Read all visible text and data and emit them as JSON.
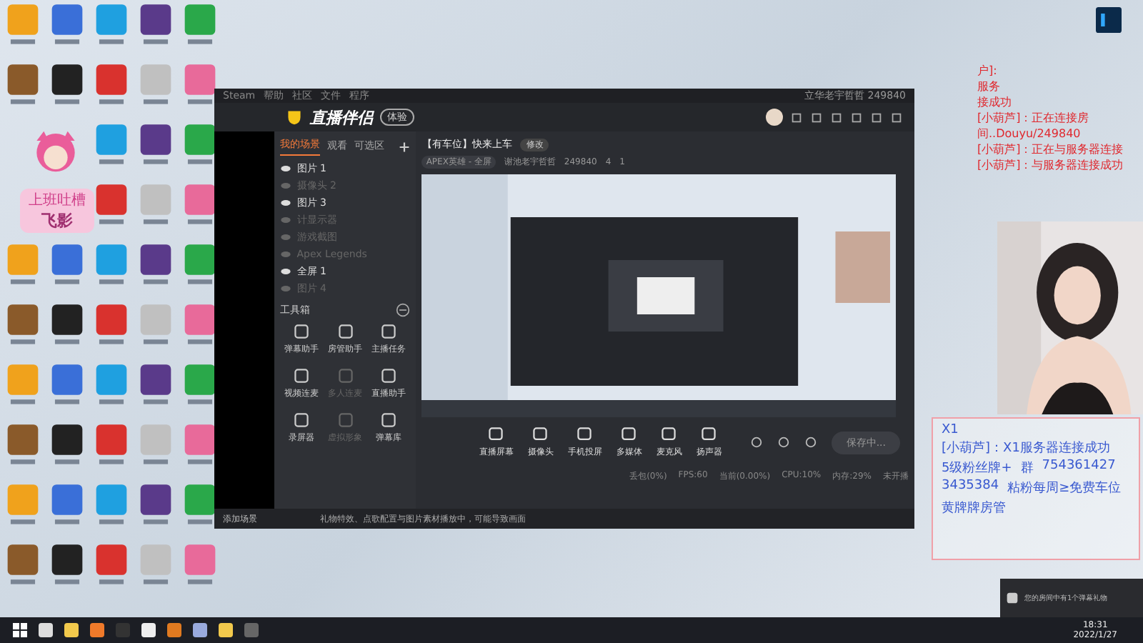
{
  "sticker": {
    "top": "上班吐槽",
    "name": "飞影"
  },
  "window": {
    "menu": [
      "Steam",
      "帮助",
      "社区",
      "文件",
      "程序"
    ],
    "brand": "直播伴侣",
    "badge": "体验",
    "account": "立华老宇哲哲 249840",
    "room": {
      "title": "【有车位】快来上车",
      "edit": "修改",
      "category": "APEX英雄 - 全屏",
      "host": "谢池老宇哲哲",
      "room_id": "249840",
      "likes": "4",
      "viewers": "1"
    },
    "scene_tabs": [
      {
        "label": "我的场景",
        "selected": true
      },
      {
        "label": "观看",
        "selected": false
      },
      {
        "label": "可选区",
        "selected": false
      }
    ],
    "sources": [
      {
        "label": "图片 1",
        "visible": true
      },
      {
        "label": "摄像头 2",
        "visible": false
      },
      {
        "label": "图片 3",
        "visible": true
      },
      {
        "label": "计显示器",
        "visible": false
      },
      {
        "label": "游戏截图",
        "visible": false
      },
      {
        "label": "Apex Legends",
        "visible": false
      },
      {
        "label": "全屏 1",
        "visible": true
      },
      {
        "label": "图片 4",
        "visible": false
      }
    ],
    "toolbox_title": "工具箱",
    "tools": [
      {
        "label": "弹幕助手",
        "disabled": false
      },
      {
        "label": "房管助手",
        "disabled": false
      },
      {
        "label": "主播任务",
        "disabled": false
      },
      {
        "label": "视频连麦",
        "disabled": false
      },
      {
        "label": "多人连麦",
        "disabled": true
      },
      {
        "label": "直播助手",
        "disabled": false
      },
      {
        "label": "录屏器",
        "disabled": false
      },
      {
        "label": "虚拟形象",
        "disabled": true
      },
      {
        "label": "弹幕库",
        "disabled": false
      }
    ],
    "controls": [
      "直播屏幕",
      "摄像头",
      "手机投屏",
      "多媒体",
      "麦克风",
      "扬声器"
    ],
    "start_button": "保存中...",
    "status": [
      "丢包(0%)",
      "FPS:60",
      "当前(0.00%)",
      "CPU:10%",
      "内存:29%",
      "未开播"
    ],
    "notice": "礼物特效、点歌配置与图片素材播放中，可能导致画面",
    "side_label": "添加场景"
  },
  "chat": {
    "top": [
      "户]:",
      "服务",
      "接成功"
    ],
    "lines": [
      "[小葫芦]：正在连接房间..Douyu/249840",
      "[小葫芦]：正在与服务器连接",
      "[小葫芦]：与服务器连接成功"
    ]
  },
  "promo": {
    "lines": [
      "X1",
      "[小葫芦]：X1服务器连接成功",
      "5级粉丝牌+",
      "群",
      "754361427",
      "3435384",
      "粘粉每周≥免费车位",
      "黄牌牌房管"
    ]
  },
  "toast": "您的房间中有1个弹幕礼物",
  "taskbar": {
    "time": "18:31",
    "date": "2022/1/27"
  }
}
